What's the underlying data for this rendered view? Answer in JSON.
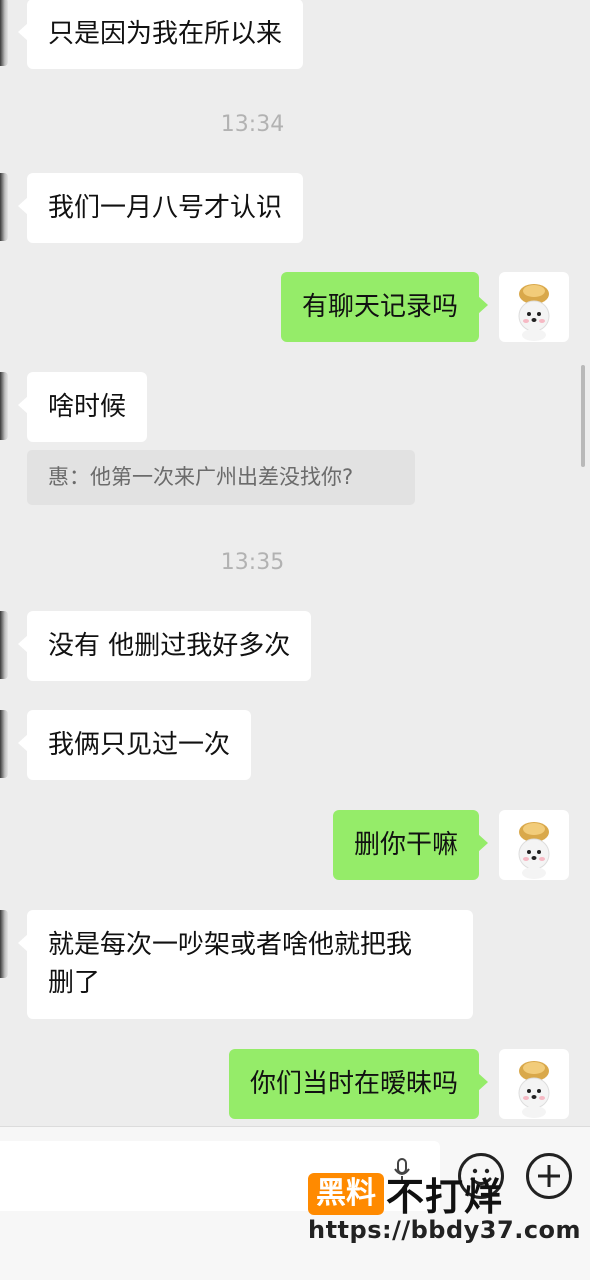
{
  "messages": [
    {
      "side": "left",
      "text": "只是因为我在所以来"
    },
    {
      "side": "left",
      "text": "我们一月八号才认识"
    },
    {
      "side": "right",
      "text": "有聊天记录吗"
    },
    {
      "side": "left",
      "text": "啥时候"
    },
    {
      "side": "left",
      "text": "没有 他删过我好多次"
    },
    {
      "side": "left",
      "text": "我俩只见过一次"
    },
    {
      "side": "right",
      "text": "删你干嘛"
    },
    {
      "side": "left",
      "text": "就是每次一吵架或者啥他就把我\n删了"
    },
    {
      "side": "right",
      "text": "你们当时在暧昧吗"
    }
  ],
  "timestamps": [
    "13:34",
    "13:35"
  ],
  "quote": "惠：他第一次来广州出差没找你?",
  "watermark": {
    "brand_orange": "黑料",
    "brand_black": "不打烊",
    "url": "https://bbdy37.com"
  },
  "colors": {
    "background": "#ededed",
    "sent_bubble": "#95ec69",
    "received_bubble": "#ffffff",
    "watermark_orange": "#ff8a00"
  },
  "icons": {
    "emoji": "smiley-face-icon",
    "more": "plus-circle-icon",
    "voice": "voice-icon"
  }
}
